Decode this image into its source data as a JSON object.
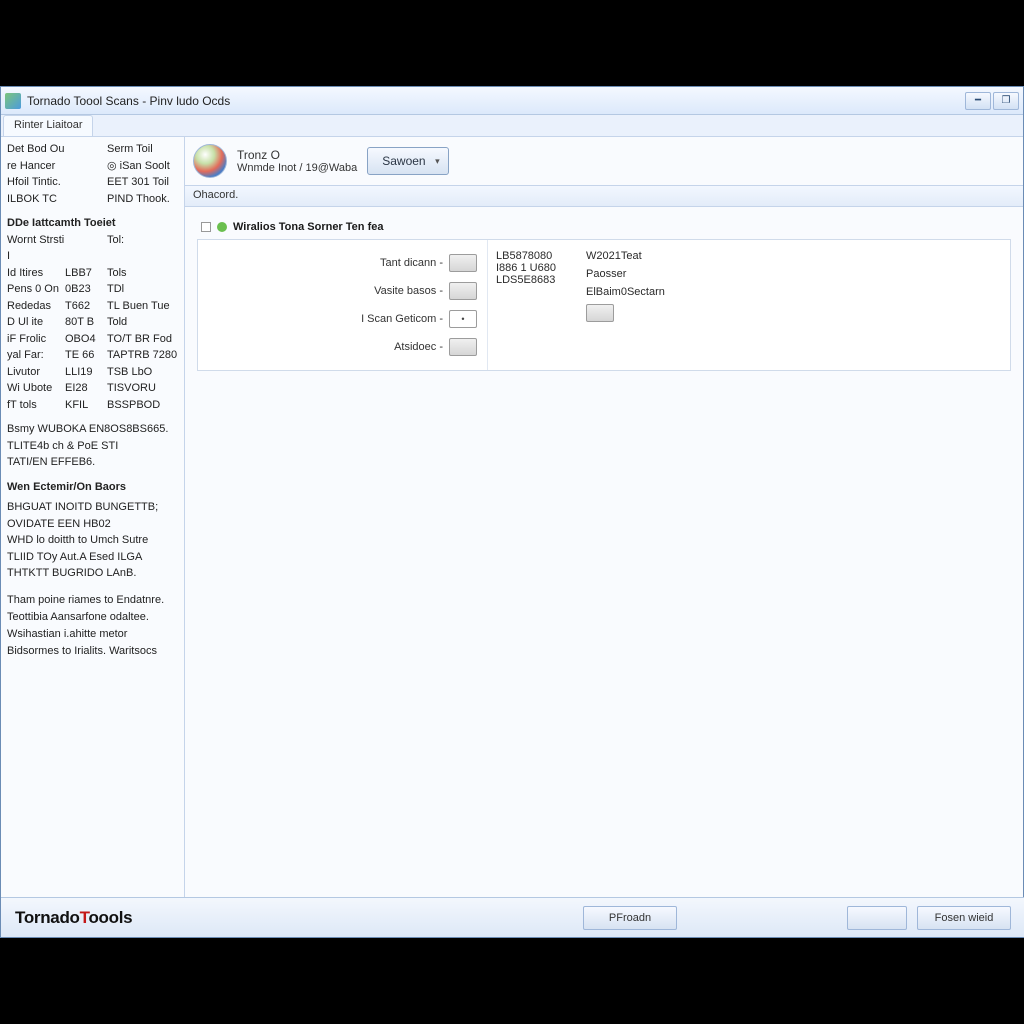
{
  "titlebar": {
    "title": "Tornado Toool Scans - Pinv ludo Ocds"
  },
  "tab": {
    "label": "Rinter Liaitoar"
  },
  "sidebar": {
    "rows": [
      {
        "c1": "Det Bod Ou",
        "c2": "",
        "c3": "Serm Toil"
      },
      {
        "c1": "re Hancer",
        "c2": "",
        "c3": "◎ iSan Soolt"
      },
      {
        "c1": "Hfoil Tintic.",
        "c2": "",
        "c3": "EET 301 Toil"
      },
      {
        "c1": "ILBOK TC",
        "c2": "",
        "c3": "PIND Thook."
      }
    ],
    "section1_title": "DDe Iattcamth Toeiet",
    "rows2": [
      {
        "c1": "Wornt Strsti I",
        "c2": "",
        "c3": "Tol:"
      },
      {
        "c1": "Id Itires",
        "c2": "LBB7",
        "c3": "Tols"
      },
      {
        "c1": "Pens 0 On",
        "c2": "0B23",
        "c3": "TDl"
      },
      {
        "c1": "Rededas",
        "c2": "T662",
        "c3": "TL Buen Tue"
      },
      {
        "c1": "D Ul ite",
        "c2": "80T B",
        "c3": "Told"
      },
      {
        "c1": "iF Frolic",
        "c2": "OBO4",
        "c3": "TO/T BR Fod"
      },
      {
        "c1": "yal Far:",
        "c2": "TE 66",
        "c3": "TAPTRB 7280"
      },
      {
        "c1": "Livutor",
        "c2": "LLI19",
        "c3": "TSB LbO"
      },
      {
        "c1": "Wi Ubote",
        "c2": "EI28",
        "c3": "TISVORU"
      },
      {
        "c1": "fT tols",
        "c2": "KFIL",
        "c3": "BSSPBOD"
      }
    ],
    "lines3": [
      "Bsmy WUBOKA EN8OS8BS665.",
      "TLITE4b ch & PoE STI",
      "TATI/EN EFFEB6."
    ],
    "section3_title": "Wen Ectemir/On Baors",
    "lines4": [
      "BHGUAT INOITD BUNGETTB;",
      "OVIDATE EEN HB02",
      "WHD lo doitth to Umch Sutre",
      "TLIID TOy Aut.A Esed ILGA",
      "THTKTT BUGRIDO LAnB."
    ],
    "para": "Tham poine riames to Endatnre. Teottibia Aansarfone odaltee. Wsihastian i.ahitte metor Bidsormes to Irialits. Waritsocs"
  },
  "header": {
    "line1": "Tronz O",
    "line2a": "Wnmde Inot /",
    "line2b": "19@Waba",
    "button": "Sawoen"
  },
  "section_label": "Ohacord.",
  "panel_title": "Wiralios Tona Sorner Ten fea",
  "form": {
    "r1": "Tant dicann",
    "r2": "Vasite basos",
    "r3": "I Scan Geticom",
    "r4": "Atsidoec"
  },
  "mid": {
    "v1": "LB5878080",
    "v2": "I886 1 U680",
    "v3": "LDS5E8683"
  },
  "right": {
    "v1": "W2021Teat",
    "v2": "Paosser",
    "v3": "ElBaim0Sectarn"
  },
  "footer": {
    "logo1": "Tornado",
    "logo2": "Toools",
    "btn1": "PFroadn",
    "btn3": "Fosen wieid"
  }
}
